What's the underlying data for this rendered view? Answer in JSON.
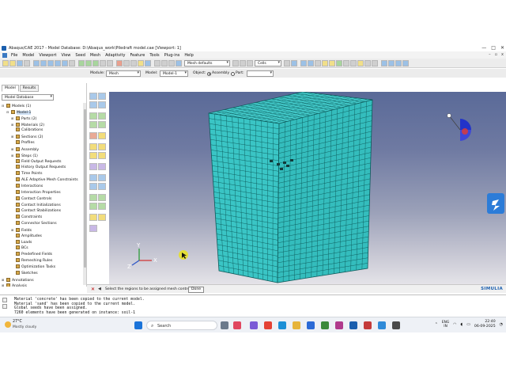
{
  "window": {
    "title": "Abaqus/CAE 2017 - Model Database: D:\\Abaqus_work\\Piledraft model.cae [Viewport: 1]",
    "controls": [
      "—",
      "□",
      "✕"
    ]
  },
  "menubar": {
    "items": [
      "File",
      "Model",
      "Viewport",
      "View",
      "Seed",
      "Mesh",
      "Adaptivity",
      "Feature",
      "Tools",
      "Plug-ins",
      "Help"
    ],
    "right_controls": [
      "–",
      "▫",
      "x"
    ]
  },
  "toolbar": {
    "mesh_defaults": "Mesh defaults",
    "cells": "Cells"
  },
  "context": {
    "module_label": "Module:",
    "module_value": "Mesh",
    "model_label": "Model:",
    "model_value": "Model-1",
    "object_label": "Object:",
    "assembly_label": "Assembly",
    "part_label": "Part:",
    "part_value": ""
  },
  "tree": {
    "tabs": [
      "Model",
      "Results"
    ],
    "active_tab": "Model",
    "database_combo": "Model Database",
    "nodes": [
      {
        "label": "Models (1)",
        "level": 0,
        "exp": "⊟"
      },
      {
        "label": "Model-1",
        "level": 1,
        "exp": "⊟",
        "selected": true
      },
      {
        "label": "Parts (2)",
        "level": 2,
        "exp": "⊞"
      },
      {
        "label": "Materials (2)",
        "level": 2,
        "exp": "⊞"
      },
      {
        "label": "Calibrations",
        "level": 2,
        "exp": ""
      },
      {
        "label": "Sections (2)",
        "level": 2,
        "exp": "⊞"
      },
      {
        "label": "Profiles",
        "level": 2,
        "exp": ""
      },
      {
        "label": "Assembly",
        "level": 2,
        "exp": "⊞"
      },
      {
        "label": "Steps (1)",
        "level": 2,
        "exp": "⊞"
      },
      {
        "label": "Field Output Requests",
        "level": 2,
        "exp": ""
      },
      {
        "label": "History Output Requests",
        "level": 2,
        "exp": ""
      },
      {
        "label": "Time Points",
        "level": 2,
        "exp": ""
      },
      {
        "label": "ALE Adaptive Mesh Constraints",
        "level": 2,
        "exp": ""
      },
      {
        "label": "Interactions",
        "level": 2,
        "exp": ""
      },
      {
        "label": "Interaction Properties",
        "level": 2,
        "exp": ""
      },
      {
        "label": "Contact Controls",
        "level": 2,
        "exp": ""
      },
      {
        "label": "Contact Initializations",
        "level": 2,
        "exp": ""
      },
      {
        "label": "Contact Stabilizations",
        "level": 2,
        "exp": ""
      },
      {
        "label": "Constraints",
        "level": 2,
        "exp": ""
      },
      {
        "label": "Connector Sections",
        "level": 2,
        "exp": ""
      },
      {
        "label": "Fields",
        "level": 2,
        "exp": "⊞"
      },
      {
        "label": "Amplitudes",
        "level": 2,
        "exp": ""
      },
      {
        "label": "Loads",
        "level": 2,
        "exp": ""
      },
      {
        "label": "BCs",
        "level": 2,
        "exp": ""
      },
      {
        "label": "Predefined Fields",
        "level": 2,
        "exp": ""
      },
      {
        "label": "Remeshing Rules",
        "level": 2,
        "exp": ""
      },
      {
        "label": "Optimization Tasks",
        "level": 2,
        "exp": ""
      },
      {
        "label": "Sketches",
        "level": 2,
        "exp": ""
      },
      {
        "label": "Annotations",
        "level": 0,
        "exp": "⊞"
      },
      {
        "label": "Analysis",
        "level": 0,
        "exp": "⊞"
      }
    ]
  },
  "viewport": {
    "mesh_color": "#3cc8c8",
    "mesh_line_color": "#0c5a5a",
    "triad": {
      "x": "X",
      "y": "Y",
      "z": "Z"
    }
  },
  "prompt": {
    "text": "Select the regions to be assigned mesh controls",
    "done_label": "Done",
    "brand": "SIMULIA"
  },
  "messages": [
    "Material 'concrete' has been copied to the current model.",
    "Material 'sand' has been copied to the current model.",
    "Global seeds have been assigned.",
    "7260 elements have been generated on instance: soil-1"
  ],
  "taskbar": {
    "temperature": "27°C",
    "condition": "Mostly cloudy",
    "search_placeholder": "Search",
    "lang_top": "ENG",
    "lang_bottom": "IN",
    "time": "22:40",
    "date": "06-09-2025"
  }
}
